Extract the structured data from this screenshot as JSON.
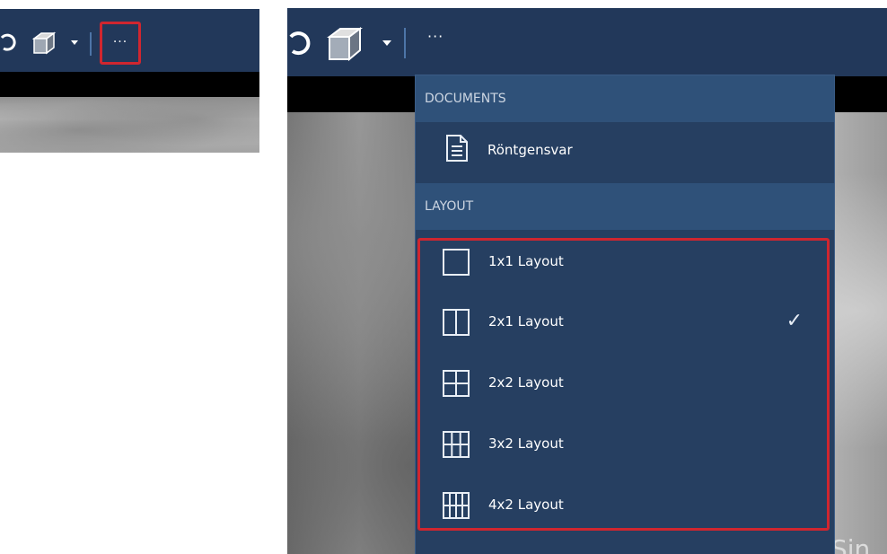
{
  "left_toolbar": {
    "more_label": "···"
  },
  "right_toolbar": {
    "more_label": "···"
  },
  "xray_text": "Sin",
  "menu": {
    "documents_header": "DOCUMENTS",
    "documents": [
      {
        "label": "Röntgensvar",
        "icon": "document-icon"
      }
    ],
    "layout_header": "LAYOUT",
    "layouts": [
      {
        "label": "1x1 Layout",
        "icon": "layout-1x1-icon",
        "checked": false
      },
      {
        "label": "2x1 Layout",
        "icon": "layout-2x1-icon",
        "checked": true
      },
      {
        "label": "2x2 Layout",
        "icon": "layout-2x2-icon",
        "checked": false
      },
      {
        "label": "3x2 Layout",
        "icon": "layout-3x2-icon",
        "checked": false
      },
      {
        "label": "4x2 Layout",
        "icon": "layout-4x2-icon",
        "checked": false
      }
    ],
    "check_mark": "✓"
  },
  "colors": {
    "toolbar_bg": "#22385a",
    "menu_bg": "#263f61",
    "section_header_bg": "#2f5179",
    "highlight_border": "#d0262f"
  }
}
